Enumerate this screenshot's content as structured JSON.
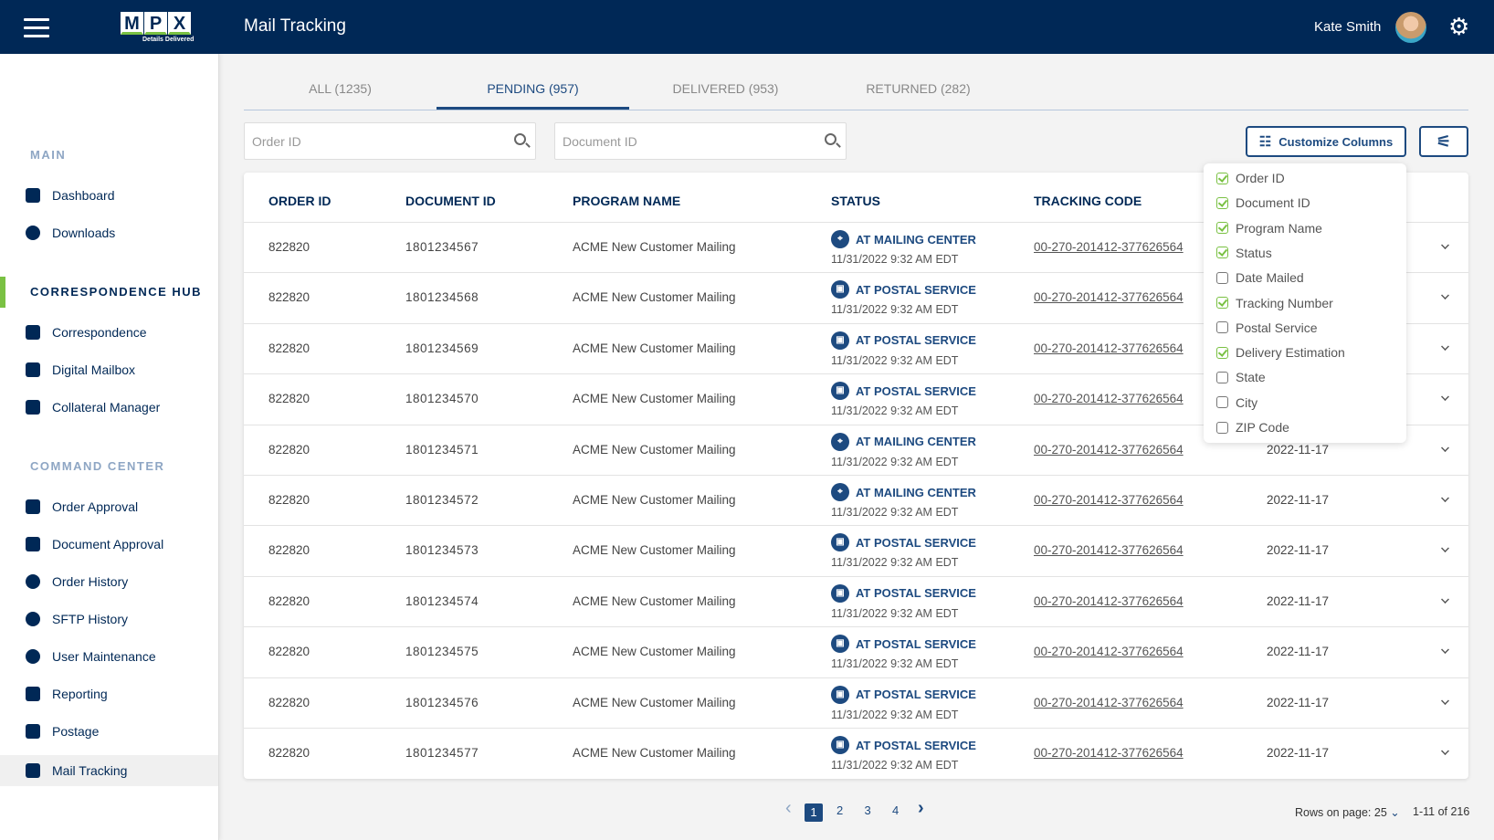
{
  "header": {
    "menu_icon": "hamburger-icon",
    "logo_text": [
      "M",
      "P",
      "X"
    ],
    "logo_tagline": "Details Delivered",
    "title": "Mail Tracking",
    "user_name": "Kate Smith",
    "settings_icon": "gear-icon"
  },
  "sidebar": {
    "sections": [
      {
        "label": "MAIN",
        "items": [
          {
            "label": "Dashboard",
            "icon": "bar-chart-icon"
          },
          {
            "label": "Downloads",
            "icon": "download-icon"
          }
        ]
      },
      {
        "label": "CORRESPONDENCE HUB",
        "items": [
          {
            "label": "Correspondence",
            "icon": "document-search-icon"
          },
          {
            "label": "Digital Mailbox",
            "icon": "envelope-icon"
          },
          {
            "label": "Collateral Manager",
            "icon": "edit-document-icon"
          }
        ]
      },
      {
        "label": "COMMAND CENTER",
        "items": [
          {
            "label": "Order Approval",
            "icon": "truck-icon"
          },
          {
            "label": "Document Approval",
            "icon": "document-check-icon"
          },
          {
            "label": "Order History",
            "icon": "history-icon"
          },
          {
            "label": "SFTP History",
            "icon": "sftp-icon"
          },
          {
            "label": "User Maintenance",
            "icon": "user-icon"
          },
          {
            "label": "Reporting",
            "icon": "report-icon"
          },
          {
            "label": "Postage",
            "icon": "postage-icon"
          },
          {
            "label": "Mail Tracking",
            "icon": "mail-tracking-icon"
          }
        ]
      }
    ],
    "active_item": "Mail Tracking",
    "active_section": "CORRESPONDENCE HUB"
  },
  "tabs": [
    {
      "label": "ALL (1235)"
    },
    {
      "label": "PENDING (957)",
      "active": true
    },
    {
      "label": "DELIVERED (953)"
    },
    {
      "label": "RETURNED (282)"
    }
  ],
  "filters": {
    "order_id_placeholder": "Order ID",
    "document_id_placeholder": "Document ID",
    "customize_label": "Customize Columns"
  },
  "table": {
    "columns": [
      "ORDER ID",
      "DOCUMENT ID",
      "PROGRAM NAME",
      "STATUS",
      "TRACKING CODE"
    ],
    "rows": [
      {
        "order": "822820",
        "doc": "1801234567",
        "program": "ACME New Customer Mailing",
        "status": "AT MAILING CENTER",
        "time": "11/31/2022 9:32 AM EDT",
        "tracking": "00-270-201412-377626564",
        "date": ""
      },
      {
        "order": "822820",
        "doc": "1801234568",
        "program": "ACME New Customer Mailing",
        "status": "AT POSTAL SERVICE",
        "time": "11/31/2022 9:32 AM EDT",
        "tracking": "00-270-201412-377626564",
        "date": ""
      },
      {
        "order": "822820",
        "doc": "1801234569",
        "program": "ACME New Customer Mailing",
        "status": "AT POSTAL SERVICE",
        "time": "11/31/2022 9:32 AM EDT",
        "tracking": "00-270-201412-377626564",
        "date": ""
      },
      {
        "order": "822820",
        "doc": "1801234570",
        "program": "ACME New Customer Mailing",
        "status": "AT POSTAL SERVICE",
        "time": "11/31/2022 9:32 AM EDT",
        "tracking": "00-270-201412-377626564",
        "date": ""
      },
      {
        "order": "822820",
        "doc": "1801234571",
        "program": "ACME New Customer Mailing",
        "status": "AT MAILING CENTER",
        "time": "11/31/2022 9:32 AM EDT",
        "tracking": "00-270-201412-377626564",
        "date": "2022-11-17"
      },
      {
        "order": "822820",
        "doc": "1801234572",
        "program": "ACME New Customer Mailing",
        "status": "AT MAILING CENTER",
        "time": "11/31/2022 9:32 AM EDT",
        "tracking": "00-270-201412-377626564",
        "date": "2022-11-17"
      },
      {
        "order": "822820",
        "doc": "1801234573",
        "program": "ACME New Customer Mailing",
        "status": "AT POSTAL SERVICE",
        "time": "11/31/2022 9:32 AM EDT",
        "tracking": "00-270-201412-377626564",
        "date": "2022-11-17"
      },
      {
        "order": "822820",
        "doc": "1801234574",
        "program": "ACME New Customer Mailing",
        "status": "AT POSTAL SERVICE",
        "time": "11/31/2022 9:32 AM EDT",
        "tracking": "00-270-201412-377626564",
        "date": "2022-11-17"
      },
      {
        "order": "822820",
        "doc": "1801234575",
        "program": "ACME New Customer Mailing",
        "status": "AT POSTAL SERVICE",
        "time": "11/31/2022 9:32 AM EDT",
        "tracking": "00-270-201412-377626564",
        "date": "2022-11-17"
      },
      {
        "order": "822820",
        "doc": "1801234576",
        "program": "ACME New Customer Mailing",
        "status": "AT POSTAL SERVICE",
        "time": "11/31/2022 9:32 AM EDT",
        "tracking": "00-270-201412-377626564",
        "date": "2022-11-17"
      },
      {
        "order": "822820",
        "doc": "1801234577",
        "program": "ACME New Customer Mailing",
        "status": "AT POSTAL SERVICE",
        "time": "11/31/2022 9:32 AM EDT",
        "tracking": "00-270-201412-377626564",
        "date": "2022-11-17"
      }
    ]
  },
  "column_menu": [
    {
      "label": "Order ID",
      "checked": true
    },
    {
      "label": "Document ID",
      "checked": true
    },
    {
      "label": "Program Name",
      "checked": true
    },
    {
      "label": "Status",
      "checked": true
    },
    {
      "label": "Date Mailed",
      "checked": false
    },
    {
      "label": "Tracking Number",
      "checked": true
    },
    {
      "label": "Postal Service",
      "checked": false
    },
    {
      "label": "Delivery Estimation",
      "checked": true
    },
    {
      "label": "State",
      "checked": false
    },
    {
      "label": "City",
      "checked": false
    },
    {
      "label": "ZIP Code",
      "checked": false
    }
  ],
  "pagination": {
    "pages": [
      "1",
      "2",
      "3",
      "4"
    ],
    "current": "1",
    "rows_label": "Rows on page:",
    "rows_value": "25",
    "range": "1-11 of 216"
  },
  "colors": {
    "navy": "#002856",
    "accent_green": "#7ac143",
    "primary_blue": "#1d4a80"
  }
}
